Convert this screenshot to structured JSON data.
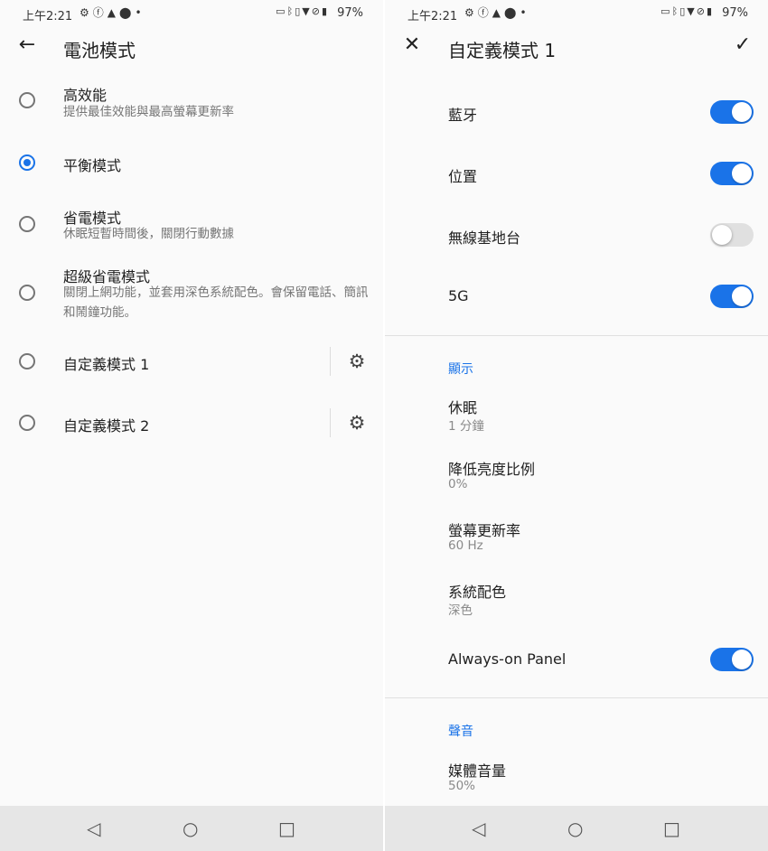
{
  "status_bar": {
    "time": "上午2:21",
    "left_icons": [
      "gear-icon",
      "facebook-icon",
      "warning-icon",
      "location-icon",
      "dot-icon"
    ],
    "right_icons": [
      "auto-icon",
      "bluetooth-icon",
      "vibrate-icon",
      "wifi-icon",
      "no-sim-icon"
    ],
    "battery": "97%",
    "battery_icon": "▮"
  },
  "left": {
    "title": "電池模式",
    "back_glyph": "←",
    "options": [
      {
        "title": "高效能",
        "subtitle": "提供最佳效能與最高螢幕更新率",
        "selected": false
      },
      {
        "title": "平衡模式",
        "selected": true
      },
      {
        "title": "省電模式",
        "subtitle": "休眠短暫時間後，關閉行動數據",
        "selected": false
      },
      {
        "title": "超級省電模式",
        "subtitle": "關閉上網功能，並套用深色系統配色。會保留電話、簡訊和鬧鐘功能。",
        "selected": false
      },
      {
        "title": "自定義模式 1",
        "selected": false,
        "has_settings": true
      },
      {
        "title": "自定義模式 2",
        "selected": false,
        "has_settings": true
      }
    ],
    "gear_glyph": "⚙"
  },
  "right": {
    "title": "自定義模式 1",
    "close_glyph": "✕",
    "check_glyph": "✓",
    "toggles": [
      {
        "label": "藍牙",
        "on": true
      },
      {
        "label": "位置",
        "on": true
      },
      {
        "label": "無線基地台",
        "on": false
      },
      {
        "label": "5G",
        "on": true
      }
    ],
    "display_section": {
      "header": "顯示",
      "items": [
        {
          "title": "休眠",
          "value": "1 分鐘"
        },
        {
          "title": "降低亮度比例",
          "value": "0%"
        },
        {
          "title": "螢幕更新率",
          "value": "60 Hz"
        },
        {
          "title": "系統配色",
          "value": "深色"
        }
      ],
      "always_on": {
        "label": "Always-on Panel",
        "on": true
      }
    },
    "sound_section": {
      "header": "聲音",
      "items": [
        {
          "title": "媒體音量",
          "value": "50%"
        }
      ]
    }
  },
  "nav_bar": {
    "back": "◁",
    "home": "○",
    "recents": "□"
  },
  "colors": {
    "accent": "#1a73e8",
    "background": "#fafafa",
    "navbar": "#e6e6e6"
  }
}
